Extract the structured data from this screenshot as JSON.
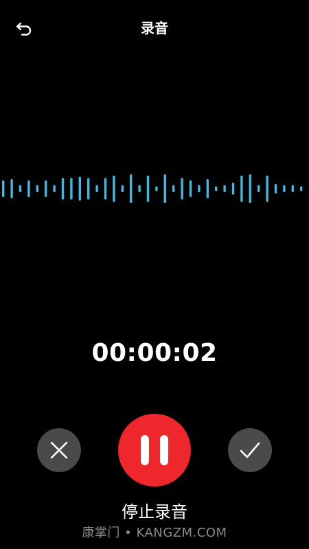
{
  "header": {
    "back_icon": "back-arrow-icon",
    "title": "录音"
  },
  "recording": {
    "waveform_color": "#41b8df",
    "waveform_levels": [
      0.35,
      0.4,
      0.15,
      0.35,
      0.15,
      0.35,
      0.15,
      0.45,
      0.45,
      0.5,
      0.45,
      0.15,
      0.45,
      0.55,
      0.15,
      0.6,
      0.15,
      0.55,
      0.1,
      0.6,
      0.15,
      0.45,
      0.35,
      0.15,
      0.4,
      0.1,
      0.15,
      0.25,
      0.55,
      0.6,
      0.15,
      0.55,
      0.2,
      0.15,
      0.15,
      0.1,
      0.35,
      0.45,
      0.15,
      0.1,
      0.4,
      0.2,
      0.15,
      0.35,
      0.15,
      0.15,
      0.35,
      0.3,
      0.15,
      0.3,
      0.15,
      0.35,
      0.15,
      0.4,
      0.35,
      0.1,
      0.35,
      0.4
    ],
    "timer": "00:00:02"
  },
  "controls": {
    "cancel_icon": "close-icon",
    "pause_icon": "pause-icon",
    "confirm_icon": "checkmark-icon",
    "pause_color": "#f0262d",
    "secondary_color": "#4a4a4a"
  },
  "action_label": "停止录音",
  "watermark": "康掌门 • KANGZM.COM"
}
